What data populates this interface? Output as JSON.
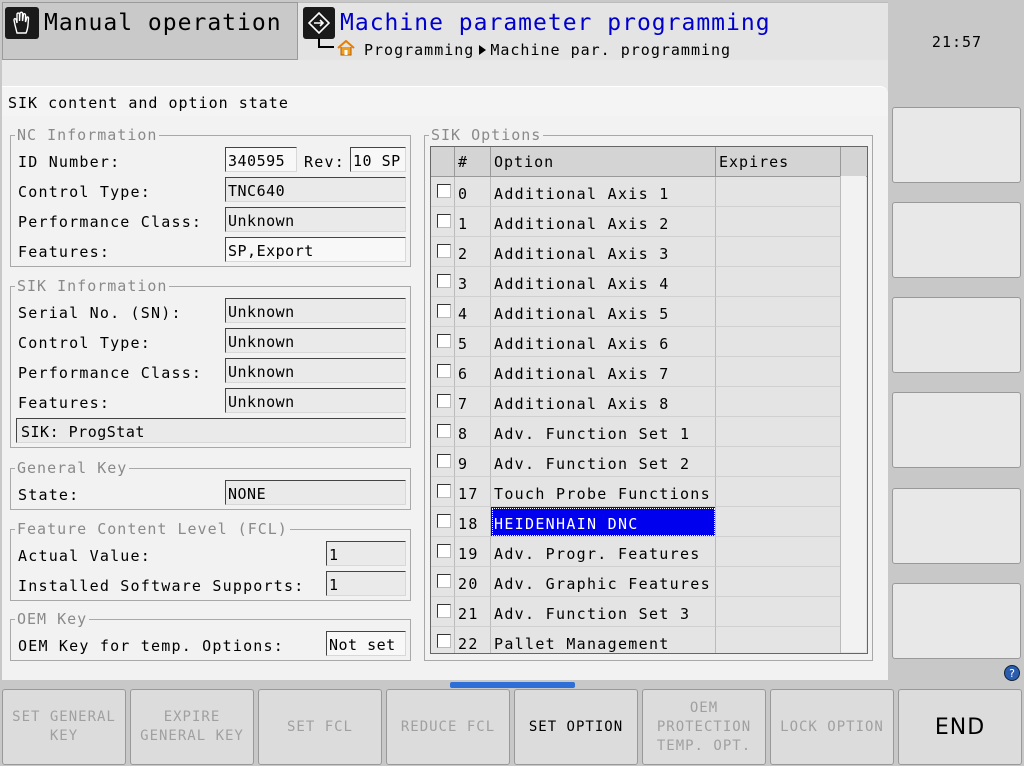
{
  "header": {
    "mode_title": "Manual operation",
    "mode_icon": "hand-icon",
    "program_title": "Machine parameter programming",
    "program_icon": "program-arrow-icon",
    "breadcrumb": [
      "Programming",
      "Machine par. programming"
    ],
    "clock": "21:57"
  },
  "dialog": {
    "title": "SIK content and option state",
    "nc_info": {
      "legend": "NC Information",
      "id_label": "ID Number:",
      "id_value": "340595",
      "rev_label": "Rev:",
      "rev_value": "10 SP",
      "control_type_label": "Control Type:",
      "control_type_value": "TNC640",
      "perf_class_label": "Performance Class:",
      "perf_class_value": "Unknown",
      "features_label": "Features:",
      "features_value": "SP,Export"
    },
    "sik_info": {
      "legend": "SIK Information",
      "serial_label": "Serial No. (SN):",
      "serial_value": "Unknown",
      "control_type_label": "Control Type:",
      "control_type_value": "Unknown",
      "perf_class_label": "Performance Class:",
      "perf_class_value": "Unknown",
      "features_label": "Features:",
      "features_value": "Unknown",
      "sik_status": "SIK: ProgStat"
    },
    "general_key": {
      "legend": "General Key",
      "state_label": "State:",
      "state_value": "NONE"
    },
    "fcl": {
      "legend": "Feature Content Level (FCL)",
      "actual_label": "Actual Value:",
      "actual_value": "1",
      "installed_label": "Installed Software Supports:",
      "installed_value": "1"
    },
    "oem_key": {
      "legend": "OEM Key",
      "label": "OEM Key for temp. Options:",
      "value": "Not set"
    },
    "sik_options": {
      "legend": "SIK Options",
      "columns": [
        "#",
        "Option",
        "Expires"
      ],
      "rows": [
        {
          "num": "0",
          "option": "Additional Axis 1",
          "expires": ""
        },
        {
          "num": "1",
          "option": "Additional Axis 2",
          "expires": ""
        },
        {
          "num": "2",
          "option": "Additional Axis 3",
          "expires": ""
        },
        {
          "num": "3",
          "option": "Additional Axis 4",
          "expires": ""
        },
        {
          "num": "4",
          "option": "Additional Axis 5",
          "expires": ""
        },
        {
          "num": "5",
          "option": "Additional Axis 6",
          "expires": ""
        },
        {
          "num": "6",
          "option": "Additional Axis 7",
          "expires": ""
        },
        {
          "num": "7",
          "option": "Additional Axis 8",
          "expires": ""
        },
        {
          "num": "8",
          "option": "Adv. Function Set 1",
          "expires": ""
        },
        {
          "num": "9",
          "option": "Adv. Function Set 2",
          "expires": ""
        },
        {
          "num": "17",
          "option": "Touch Probe Functions",
          "expires": ""
        },
        {
          "num": "18",
          "option": "HEIDENHAIN DNC",
          "expires": ""
        },
        {
          "num": "19",
          "option": "Adv. Progr. Features",
          "expires": ""
        },
        {
          "num": "20",
          "option": "Adv. Graphic Features",
          "expires": ""
        },
        {
          "num": "21",
          "option": "Adv. Function Set 3",
          "expires": ""
        },
        {
          "num": "22",
          "option": "Pallet Management",
          "expires": ""
        }
      ],
      "selected_num": "18"
    }
  },
  "softkeys": [
    {
      "label": "SET GENERAL\nKEY",
      "enabled": false
    },
    {
      "label": "EXPIRE\nGENERAL KEY",
      "enabled": false
    },
    {
      "label": "SET FCL",
      "enabled": false
    },
    {
      "label": "REDUCE FCL",
      "enabled": false
    },
    {
      "label": "SET OPTION",
      "enabled": true
    },
    {
      "label": "OEM\nPROTECTION\nTEMP. OPT.",
      "enabled": false
    },
    {
      "label": "LOCK OPTION",
      "enabled": false
    },
    {
      "label": "END",
      "enabled": true
    }
  ],
  "colors": {
    "selection": "#0000ee",
    "title_blue": "#0000cc"
  }
}
